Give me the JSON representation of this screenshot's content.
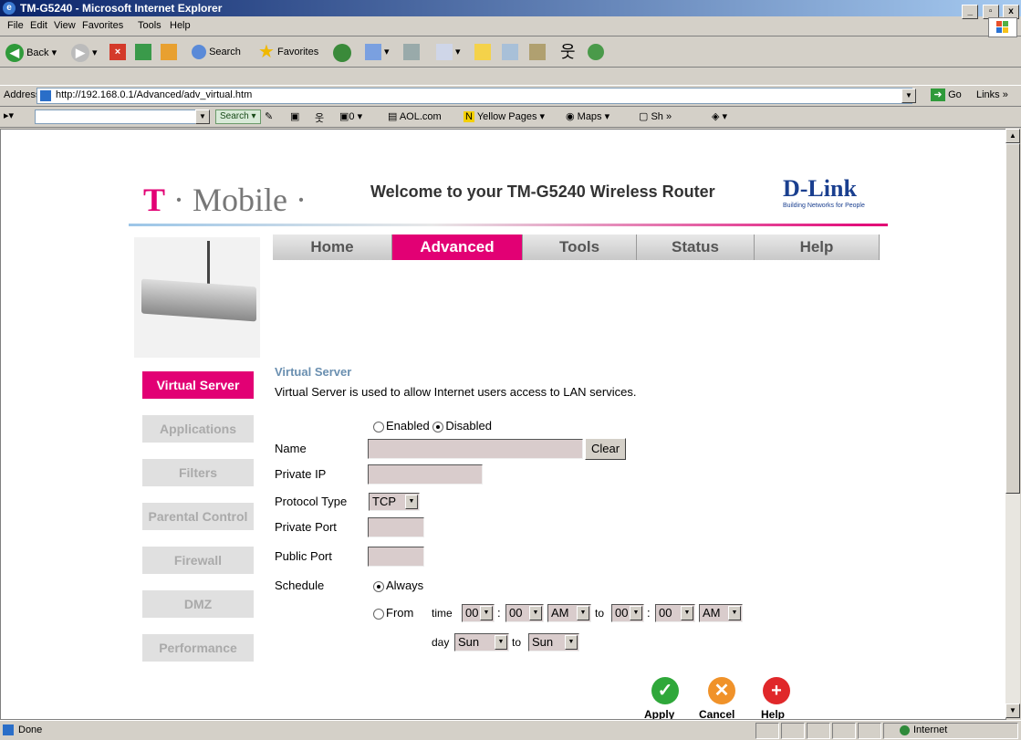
{
  "window": {
    "title": "TM-G5240 - Microsoft Internet Explorer",
    "min": "_",
    "max": "▫",
    "close": "x"
  },
  "menu": [
    "File",
    "Edit",
    "View",
    "Favorites",
    "Tools",
    "Help"
  ],
  "toolbar": {
    "back": "Back",
    "search": "Search",
    "favorites": "Favorites"
  },
  "address": {
    "label": "Address",
    "url": "http://192.168.0.1/Advanced/adv_virtual.htm",
    "go": "Go",
    "links": "Links"
  },
  "linksbar": {
    "search_btn": "Search",
    "counter": "0",
    "items": [
      "AOL.com",
      "Yellow Pages",
      "Maps",
      "Sh"
    ]
  },
  "status": {
    "text": "Done",
    "zone": "Internet"
  },
  "page": {
    "brand": "Mobile",
    "welcome": "Welcome to your TM-G5240 Wireless Router",
    "dlink": "D-Link",
    "dlink_sub": "Building Networks for People",
    "nav": [
      "Home",
      "Advanced",
      "Tools",
      "Status",
      "Help"
    ],
    "active_nav": "Advanced",
    "sidebar": [
      "Virtual Server",
      "Applications",
      "Filters",
      "Parental Control",
      "Firewall",
      "DMZ",
      "Performance"
    ],
    "section_title": "Virtual Server",
    "section_desc": "Virtual Server is used to allow Internet users access to LAN services.",
    "enabled_label": "Enabled",
    "disabled_label": "Disabled",
    "enabled_state": "Disabled",
    "name_label": "Name",
    "name_value": "",
    "clear_label": "Clear",
    "private_ip_label": "Private IP",
    "protocol_label": "Protocol Type",
    "protocol_value": "TCP",
    "private_port_label": "Private Port",
    "public_port_label": "Public Port",
    "schedule_label": "Schedule",
    "always_label": "Always",
    "from_label": "From",
    "time_label": "time",
    "day_label": "day",
    "to_label": "to",
    "colon": ":",
    "schedule_mode": "Always",
    "from_hour": "00",
    "from_min": "00",
    "from_ampm": "AM",
    "to_hour": "00",
    "to_min": "00",
    "to_ampm": "AM",
    "day_from": "Sun",
    "day_to": "Sun",
    "apply_label": "Apply",
    "cancel_label": "Cancel",
    "help_label": "Help"
  }
}
